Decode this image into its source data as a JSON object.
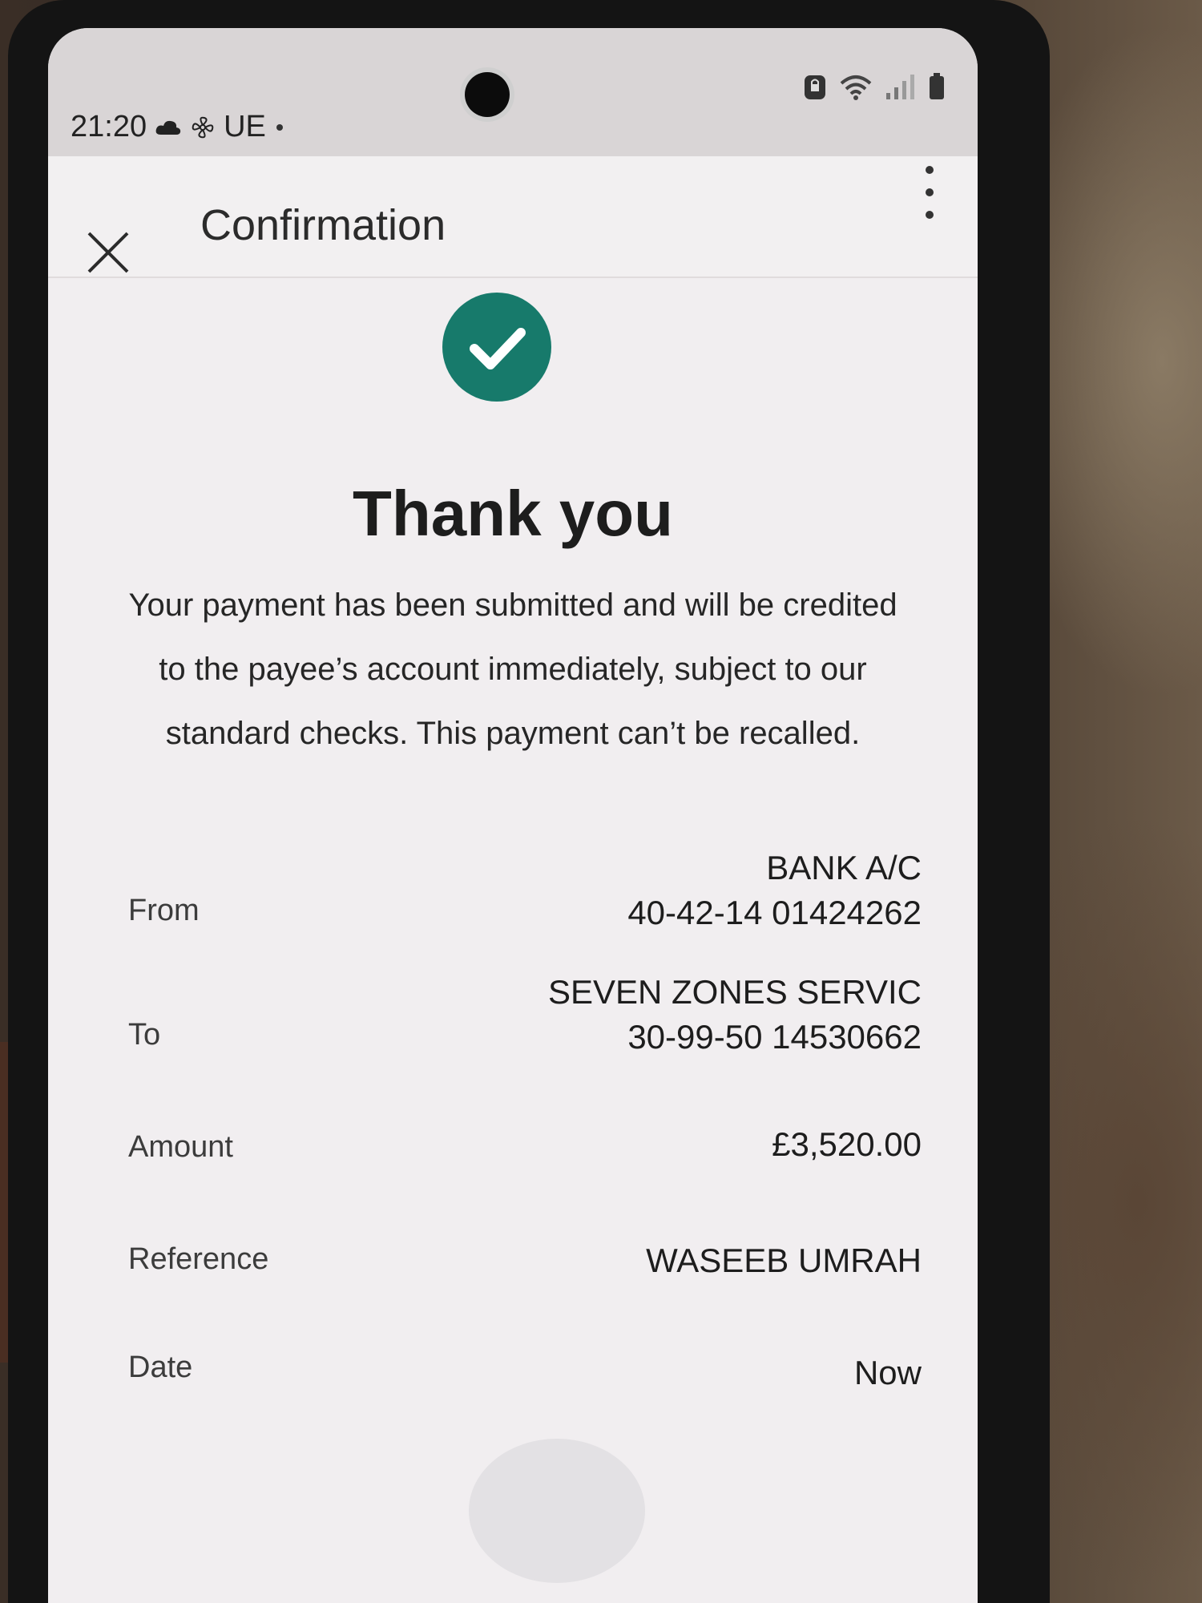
{
  "status_bar": {
    "time": "21:20",
    "carrier": "UE"
  },
  "header": {
    "title": "Confirmation"
  },
  "confirmation": {
    "heading": "Thank you",
    "message": "Your payment has been submitted and will be credited to the payee’s account immediately, subject to our standard checks. This payment can’t be recalled."
  },
  "details": {
    "from": {
      "label": "From",
      "line1": "BANK A/C",
      "line2": "40-42-14 01424262"
    },
    "to": {
      "label": "To",
      "line1": "SEVEN ZONES SERVIC",
      "line2": "30-99-50 14530662"
    },
    "amount": {
      "label": "Amount",
      "value": "£3,520.00"
    },
    "reference": {
      "label": "Reference",
      "value": "WASEEB UMRAH"
    },
    "date": {
      "label": "Date",
      "value": "Now"
    }
  },
  "colors": {
    "success": "#177a6b"
  }
}
